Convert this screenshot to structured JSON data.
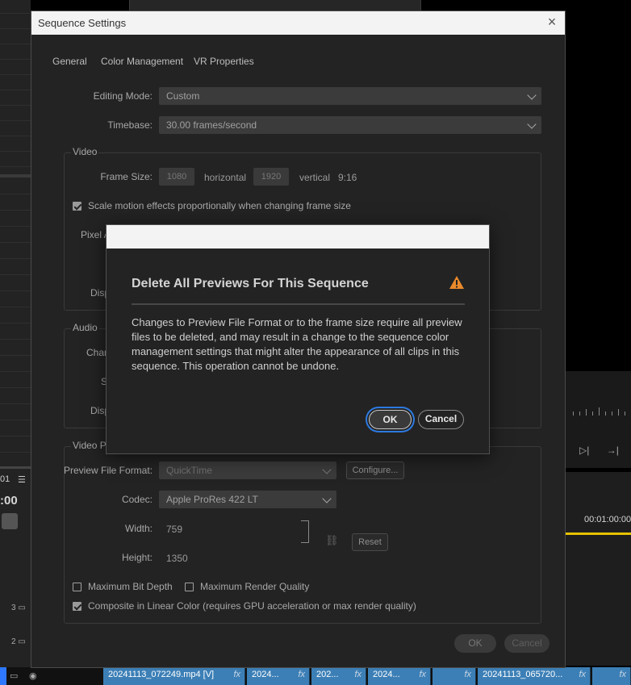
{
  "background": {
    "left_indicator": "01",
    "left_menu_icon": "hamburger-icon",
    "left_timecode": ":00",
    "right_timecode": "00:01:00:00",
    "track_labels": [
      "3",
      "2"
    ],
    "clips": [
      {
        "label": "20241113_072249.mp4 [V]",
        "fx": "fx"
      },
      {
        "label": "2024...",
        "fx": "fx"
      },
      {
        "label": "202...",
        "fx": "fx"
      },
      {
        "label": "2024...",
        "fx": "fx"
      },
      {
        "label": "",
        "fx": "fx"
      },
      {
        "label": "20241113_065720...",
        "fx": "fx"
      },
      {
        "label": "",
        "fx": "fx"
      }
    ]
  },
  "window": {
    "title": "Sequence Settings",
    "close": "×",
    "tabs": [
      "General",
      "Color Management",
      "VR Properties"
    ],
    "editing_mode": {
      "label": "Editing Mode:",
      "value": "Custom"
    },
    "timebase": {
      "label": "Timebase:",
      "value": "30.00  frames/second"
    },
    "video": {
      "title": "Video",
      "frame_size_label": "Frame Size:",
      "horizontal_value": "1080",
      "horizontal_label": "horizontal",
      "vertical_value": "1920",
      "vertical_label": "vertical",
      "aspect": "9:16",
      "scale_label": "Scale motion effects proportionally when changing frame size",
      "scale_checked": true,
      "pixel_label_partial": "Pixel A",
      "display_label_partial": "Disp"
    },
    "audio": {
      "title": "Audio",
      "channel_label_partial": "Chan",
      "sample_label_partial": "S",
      "display_label_partial": "Disp"
    },
    "video_previews": {
      "title_partial": "Video Pr",
      "format_label": "Preview File Format:",
      "format_value": "QuickTime",
      "configure_label": "Configure...",
      "codec_label": "Codec:",
      "codec_value": "Apple ProRes 422 LT",
      "width_label": "Width:",
      "width_value": "759",
      "height_label": "Height:",
      "height_value": "1350",
      "reset_label": "Reset"
    },
    "max_bit_depth": {
      "label": "Maximum Bit Depth",
      "checked": false
    },
    "max_render_quality": {
      "label": "Maximum Render Quality",
      "checked": false
    },
    "composite_linear": {
      "label": "Composite in Linear Color (requires GPU acceleration or max render quality)",
      "checked": true
    },
    "ok_label": "OK",
    "cancel_label": "Cancel"
  },
  "modal": {
    "title": "Delete All Previews For This Sequence",
    "warning_icon": "warning-icon",
    "warning_color": "#e8892b",
    "body": "Changes to Preview File Format or to the frame size require all preview files to be deleted, and may result in a change to the sequence color management settings that might alter the appearance of all clips in this sequence. This operation cannot be undone.",
    "ok_label": "OK",
    "cancel_label": "Cancel"
  }
}
